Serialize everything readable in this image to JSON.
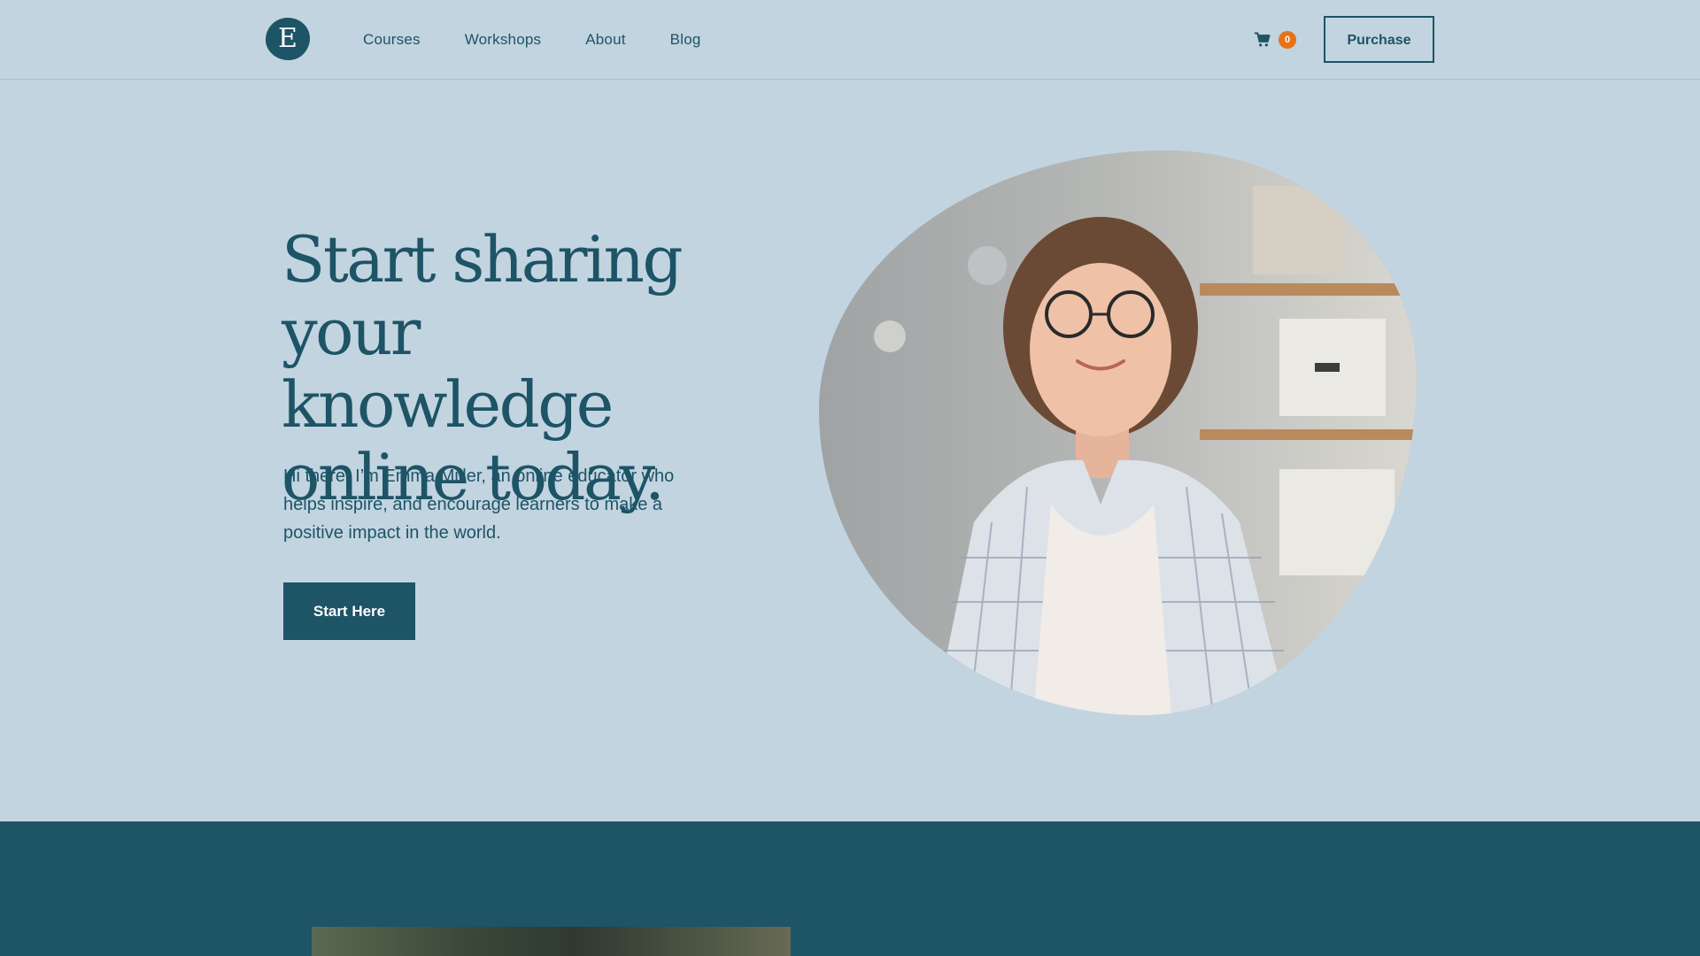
{
  "header": {
    "logo_letter": "E",
    "nav": [
      {
        "label": "Courses"
      },
      {
        "label": "Workshops"
      },
      {
        "label": "About"
      },
      {
        "label": "Blog"
      }
    ],
    "cart": {
      "icon": "cart-icon",
      "count": "0",
      "badge_color": "#e5731a"
    },
    "purchase_label": "Purchase"
  },
  "hero": {
    "title_lines": [
      "Start sharing",
      "your knowledge",
      "online today."
    ],
    "intro_lines": [
      "Hi there! I’m Emma Miller, an online educator who",
      "helps inspire, and encourage learners to make a",
      "positive impact in the world."
    ],
    "cta_label": "Start Here",
    "image": "portrait-photo"
  },
  "colors": {
    "background": "#c2d4e0",
    "primary": "#1d5466",
    "accent": "#e5731a"
  }
}
